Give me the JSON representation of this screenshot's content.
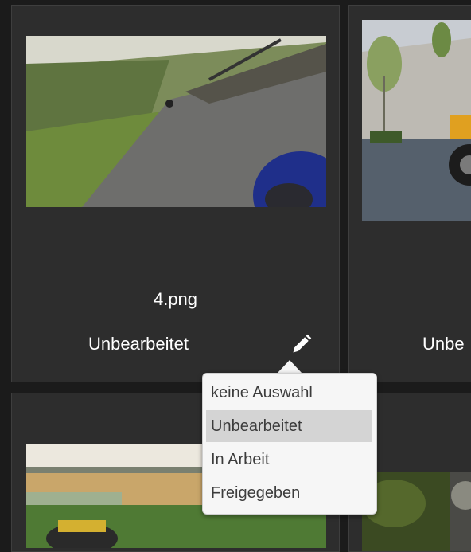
{
  "cards": [
    {
      "filename": "4.png",
      "status": "Unbearbeitet"
    },
    {
      "filename": "",
      "status": "Unbe"
    },
    {
      "filename": "",
      "status": ""
    },
    {
      "filename": "",
      "status": ""
    }
  ],
  "status_menu": {
    "options": [
      "keine Auswahl",
      "Unbearbeitet",
      "In Arbeit",
      "Freigegeben"
    ],
    "selected": "Unbearbeitet"
  },
  "icons": {
    "edit": "pencil-icon"
  }
}
